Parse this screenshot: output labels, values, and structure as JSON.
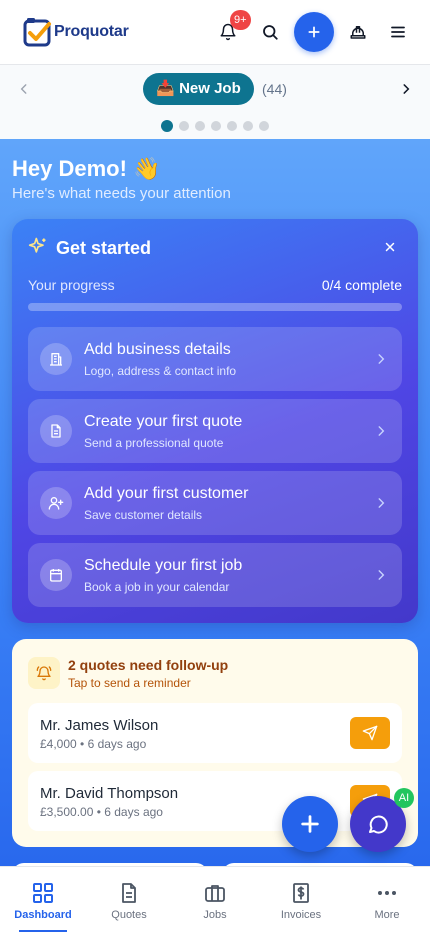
{
  "header": {
    "logo_text": "Proquotar",
    "notification_count": "9+"
  },
  "subnav": {
    "new_job_label": "📥 New Job",
    "job_count": "(44)",
    "page_total": 7,
    "page_active": 1
  },
  "greeting": {
    "title": "Hey Demo! 👋",
    "subtitle": "Here's what needs your attention"
  },
  "get_started": {
    "title": "Get started",
    "progress_label": "Your progress",
    "progress_value": "0/4 complete",
    "progress_fraction": 0,
    "tasks": [
      {
        "title": "Add business details",
        "subtitle": "Logo, address & contact info",
        "icon": "building-icon"
      },
      {
        "title": "Create your first quote",
        "subtitle": "Send a professional quote",
        "icon": "document-icon"
      },
      {
        "title": "Add your first customer",
        "subtitle": "Save customer details",
        "icon": "user-plus-icon"
      },
      {
        "title": "Schedule your first job",
        "subtitle": "Book a job in your calendar",
        "icon": "calendar-icon"
      }
    ]
  },
  "follow_up": {
    "title": "2 quotes need follow-up",
    "subtitle": "Tap to send a reminder",
    "items": [
      {
        "name": "Mr. James Wilson",
        "meta": "£4,000 • 6 days ago"
      },
      {
        "name": "Mr. David Thompson",
        "meta": "£3,500.00 • 6 days ago"
      }
    ]
  },
  "chat_badge": "AI",
  "tabbar": {
    "tabs": [
      {
        "label": "Dashboard",
        "icon": "dashboard-icon",
        "active": true
      },
      {
        "label": "Quotes",
        "icon": "quotes-icon",
        "active": false
      },
      {
        "label": "Jobs",
        "icon": "briefcase-icon",
        "active": false
      },
      {
        "label": "Invoices",
        "icon": "invoice-icon",
        "active": false
      },
      {
        "label": "More",
        "icon": "more-icon",
        "active": false
      }
    ]
  },
  "colors": {
    "primary": "#2563eb",
    "teal": "#0e7490",
    "amber": "#f59e0b",
    "badge_red": "#ef4444",
    "ai_green": "#22c55e"
  }
}
